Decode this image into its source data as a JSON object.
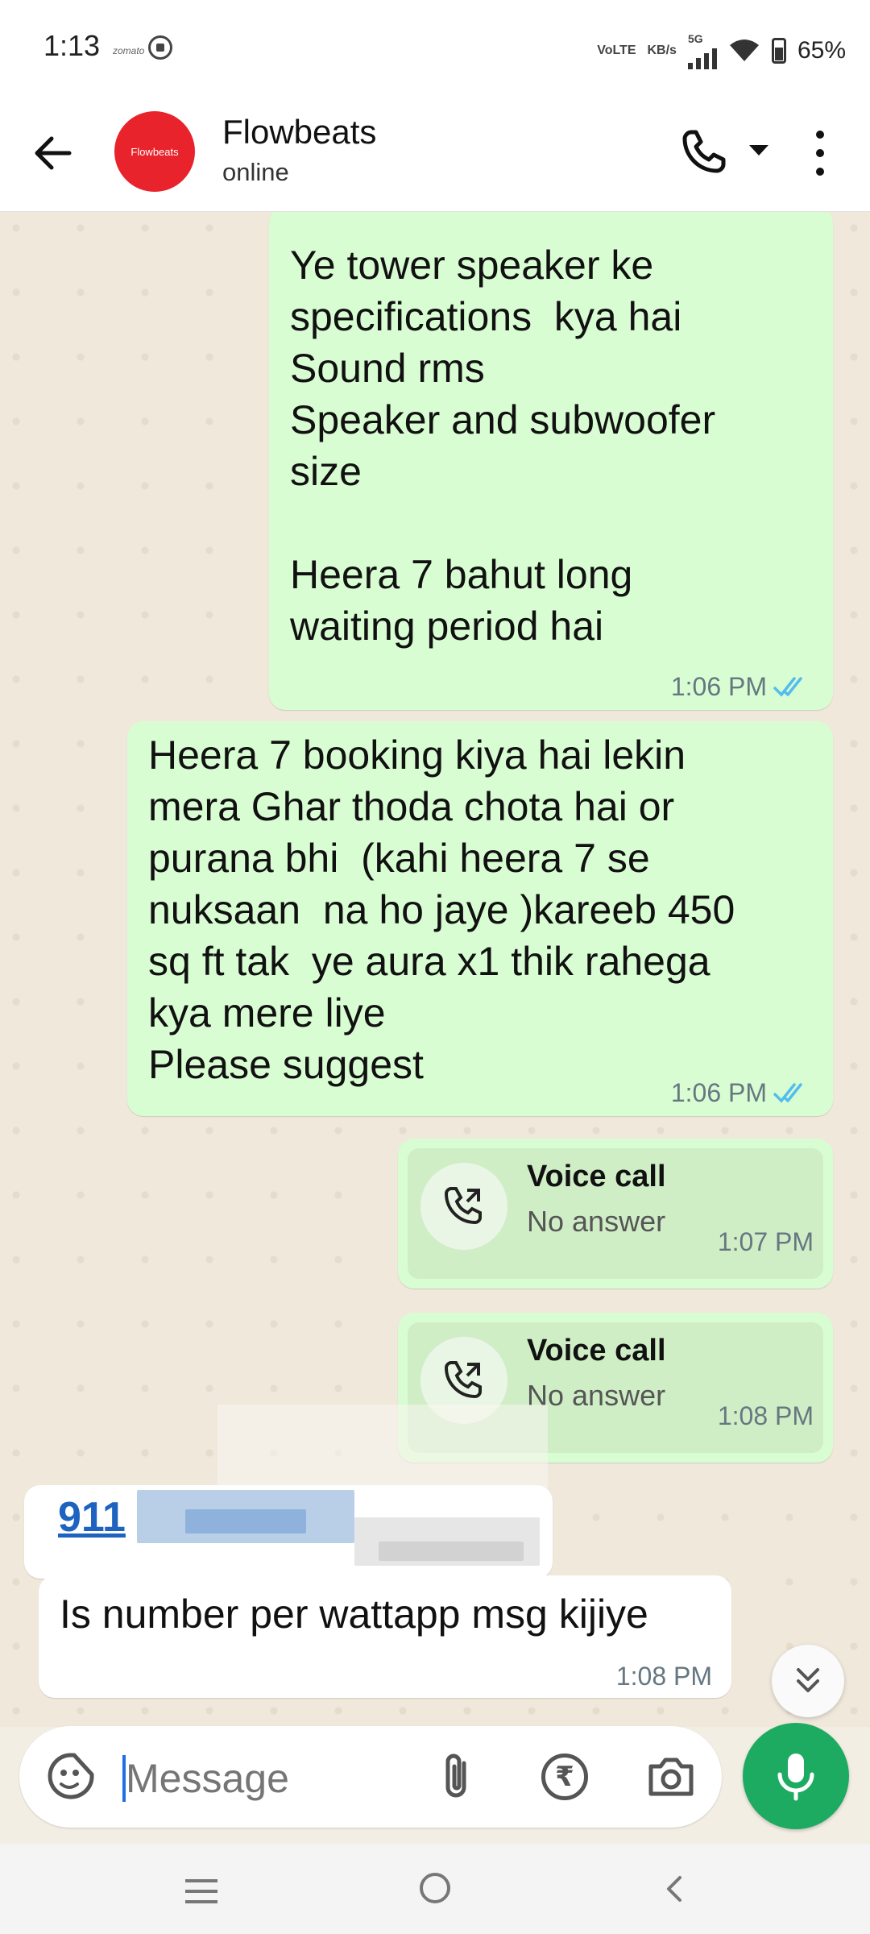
{
  "status_bar": {
    "time": "1:13",
    "tiny_label": "zomato",
    "volte": "VoLTE",
    "speed": "KB/s",
    "network": "5G",
    "battery": "65%"
  },
  "header": {
    "contact_name": "Flowbeats",
    "avatar_text": "Flowbeats",
    "status": "online",
    "avatar_color": "#e8232b"
  },
  "messages": [
    {
      "type": "outgoing",
      "text": "Ye tower speaker ke\nspecifications  kya hai\nSound rms\nSpeaker and subwoofer\nsize\n\nHeera 7 bahut long\nwaiting period hai",
      "time": "1:06 PM",
      "status": "read"
    },
    {
      "type": "outgoing",
      "text": "Heera 7 booking kiya hai lekin\nmera Ghar thoda chota hai or\npurana bhi  (kahi heera 7 se\nnuksaan  na ho jaye )kareeb 450\nsq ft tak  ye aura x1 thik rahega\nkya mere liye\nPlease suggest",
      "time": "1:06 PM",
      "status": "read"
    },
    {
      "type": "call",
      "title": "Voice call",
      "subtitle": "No answer",
      "time": "1:07 PM"
    },
    {
      "type": "call",
      "title": "Voice call",
      "subtitle": "No answer",
      "time": "1:08 PM"
    },
    {
      "type": "incoming-number",
      "text": "911"
    },
    {
      "type": "incoming",
      "text": "Is number per wattapp msg kijiye",
      "time": "1:08 PM"
    }
  ],
  "composer": {
    "placeholder": "Message",
    "rupee_symbol": "₹"
  },
  "colors": {
    "outgoing_bubble": "#d9fdd3",
    "incoming_bubble": "#ffffff",
    "accent_green": "#1daa61",
    "read_ticks": "#53bdeb"
  }
}
